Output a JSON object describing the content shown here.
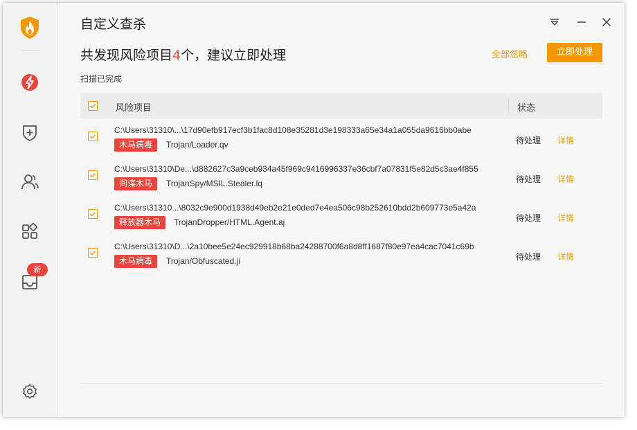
{
  "app": {
    "title": "自定义查杀"
  },
  "sidebar": {
    "items": [
      {
        "icon": "lightning-icon"
      },
      {
        "icon": "shield-plus-icon"
      },
      {
        "icon": "users-icon"
      },
      {
        "icon": "apps-icon"
      },
      {
        "icon": "inbox-icon",
        "badge": "新"
      },
      {
        "icon": "gear-icon"
      }
    ]
  },
  "header": {
    "headline_prefix": "共发现风险项目",
    "risk_count": "4",
    "headline_suffix": "个，建议立即处理",
    "ignore_all": "全部忽略",
    "handle_now": "立即处理",
    "scan_status": "扫描已完成"
  },
  "table": {
    "col_risk": "风险项目",
    "col_state": "状态",
    "rows": [
      {
        "path": "C:\\Users\\31310\\...\\17d90efb917ecf3b1fac8d108e35281d3e198333a65e34a1a055da9616bb0abe",
        "tag": "木马病毒",
        "name": "Trojan/Loader.qv",
        "state": "待处理",
        "detail": "详情",
        "checked": true
      },
      {
        "path": "C:\\Users\\31310\\De...\\d882627c3a9ceb934a45f969c9416996337e36cbf7a07831f5e82d5c3ae4f855",
        "tag": "间谍木马",
        "name": "TrojanSpy/MSIL.Stealer.lq",
        "state": "待处理",
        "detail": "详情",
        "checked": true
      },
      {
        "path": "C:\\Users\\31310...\\8032c9e900d1938d49eb2e21e0ded7e4ea506c98b252610bdd2b609773e5a42a",
        "tag": "释放器木马",
        "name": "TrojanDropper/HTML.Agent.aj",
        "state": "待处理",
        "detail": "详情",
        "checked": true
      },
      {
        "path": "C:\\Users\\31310\\D...\\2a10bee5e24ec929918b68ba24288700f6a8d8ff1687f80e97ea4cac7041c69b",
        "tag": "木马病毒",
        "name": "Trojan/Obfuscated.ji",
        "state": "待处理",
        "detail": "详情",
        "checked": true
      }
    ]
  },
  "colors": {
    "accent": "#f39800",
    "danger": "#e8453c"
  }
}
